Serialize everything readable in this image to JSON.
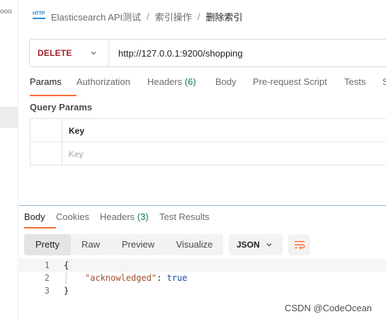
{
  "left_pane": {
    "dots": "ooo"
  },
  "breadcrumb": {
    "icon": "http-icon",
    "collection": "Elasticsearch API测试",
    "folder": "索引操作",
    "current": "删除索引",
    "separator": "/"
  },
  "request": {
    "method": "DELETE",
    "url": "http://127.0.0.1:9200/shopping"
  },
  "request_tabs": [
    {
      "label": "Params",
      "active": true
    },
    {
      "label": "Authorization"
    },
    {
      "label": "Headers",
      "count": "(6)"
    },
    {
      "label": "Body"
    },
    {
      "label": "Pre-request Script"
    },
    {
      "label": "Tests"
    },
    {
      "label": "S"
    }
  ],
  "query_params": {
    "title": "Query Params",
    "header_key": "Key",
    "placeholder_key": "Key"
  },
  "response_tabs": [
    {
      "label": "Body",
      "active": true
    },
    {
      "label": "Cookies"
    },
    {
      "label": "Headers",
      "count": "(3)"
    },
    {
      "label": "Test Results"
    }
  ],
  "view_modes": [
    "Pretty",
    "Raw",
    "Preview",
    "Visualize"
  ],
  "active_view_mode": "Pretty",
  "format": "JSON",
  "response_body": {
    "lines": [
      {
        "num": "1",
        "open": "{"
      },
      {
        "num": "2",
        "key": "\"acknowledged\"",
        "colon": ": ",
        "value": "true"
      },
      {
        "num": "3",
        "close": "}"
      }
    ]
  },
  "watermark": "CSDN @CodeOcean",
  "colors": {
    "method": "#a3212b",
    "active_tab_underline": "#ff6c37",
    "count_green": "#0c7a43",
    "json_key": "#a0522d",
    "json_value": "#1b47ae"
  }
}
